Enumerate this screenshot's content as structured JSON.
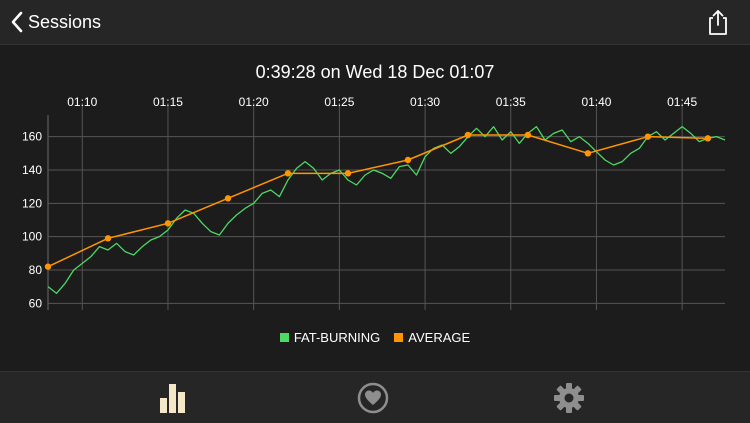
{
  "nav": {
    "back_label": "Sessions",
    "back_icon": "chevron-left-icon",
    "share_icon": "share-icon"
  },
  "title": "0:39:28 on Wed 18 Dec 01:07",
  "colors": {
    "background": "#1c1c1c",
    "bar": "#262626",
    "fat_burning": "#4cd964",
    "average": "#ff9500",
    "grid": "#555555",
    "tab_active": "#f5e8c8",
    "tab_inactive": "#8e8e8e"
  },
  "tabs": [
    {
      "name": "stats-tab",
      "icon": "bar-chart-icon",
      "active": true
    },
    {
      "name": "heart-tab",
      "icon": "heart-icon",
      "active": false
    },
    {
      "name": "settings-tab",
      "icon": "gear-icon",
      "active": false
    }
  ],
  "chart_data": {
    "type": "line",
    "x_unit": "minutes after 01:07",
    "xlim": [
      0,
      39.5
    ],
    "ylim": [
      56,
      173
    ],
    "x_ticks": [
      {
        "label": "01:10",
        "x": 2
      },
      {
        "label": "01:15",
        "x": 7
      },
      {
        "label": "01:20",
        "x": 12
      },
      {
        "label": "01:25",
        "x": 17
      },
      {
        "label": "01:30",
        "x": 22
      },
      {
        "label": "01:35",
        "x": 27
      },
      {
        "label": "01:40",
        "x": 32
      },
      {
        "label": "01:45",
        "x": 37
      }
    ],
    "y_ticks": [
      60,
      80,
      100,
      120,
      140,
      160
    ],
    "legend_position": "bottom",
    "grid": true,
    "series": [
      {
        "name": "FAT-BURNING",
        "color": "#4cd964",
        "x": [
          0,
          0.5,
          1,
          1.5,
          2,
          2.5,
          3,
          3.5,
          4,
          4.5,
          5,
          5.5,
          6,
          6.5,
          7,
          7.5,
          8,
          8.5,
          9,
          9.5,
          10,
          10.5,
          11,
          11.5,
          12,
          12.5,
          13,
          13.5,
          14,
          14.5,
          15,
          15.5,
          16,
          16.5,
          17,
          17.5,
          18,
          18.5,
          19,
          19.5,
          20,
          20.5,
          21,
          21.5,
          22,
          22.5,
          23,
          23.5,
          24,
          24.5,
          25,
          25.5,
          26,
          26.5,
          27,
          27.5,
          28,
          28.5,
          29,
          29.5,
          30,
          30.5,
          31,
          31.5,
          32,
          32.5,
          33,
          33.5,
          34,
          34.5,
          35,
          35.5,
          36,
          36.5,
          37,
          37.5,
          38,
          38.5,
          39,
          39.5
        ],
        "y": [
          70,
          66,
          72,
          80,
          84,
          88,
          94,
          92,
          96,
          91,
          89,
          94,
          98,
          100,
          104,
          111,
          116,
          114,
          108,
          103,
          101,
          108,
          113,
          117,
          120,
          126,
          128,
          124,
          134,
          141,
          145,
          141,
          134,
          138,
          140,
          134,
          131,
          137,
          140,
          138,
          135,
          142,
          143,
          137,
          148,
          153,
          155,
          150,
          154,
          160,
          165,
          160,
          166,
          158,
          163,
          156,
          162,
          166,
          158,
          162,
          164,
          157,
          160,
          156,
          151,
          146,
          143,
          145,
          150,
          153,
          160,
          163,
          158,
          162,
          166,
          162,
          157,
          159,
          160,
          158
        ]
      },
      {
        "name": "AVERAGE",
        "color": "#ff9500",
        "x": [
          0,
          3.5,
          7,
          10.5,
          14,
          17.5,
          21,
          24.5,
          28,
          31.5,
          35,
          38.5
        ],
        "y": [
          82,
          99,
          108,
          123,
          138,
          138,
          146,
          161,
          161,
          150,
          160,
          159
        ]
      }
    ]
  }
}
